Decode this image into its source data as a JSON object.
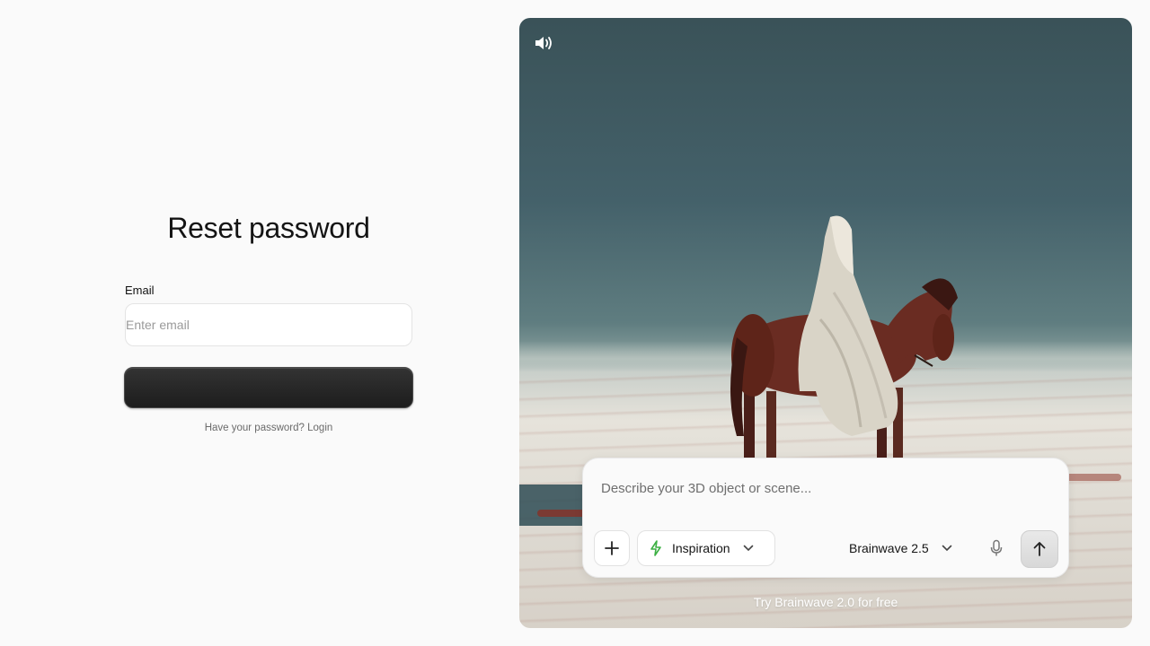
{
  "reset_form": {
    "title": "Reset password",
    "email_label": "Email",
    "email_placeholder": "Enter email",
    "email_value": "",
    "submit_label": "",
    "login_prompt": "Have your password?",
    "login_link": "Login"
  },
  "hero": {
    "sound_icon": "volume-icon"
  },
  "composer": {
    "prompt_placeholder": "Describe your 3D object or scene...",
    "add_icon": "plus-icon",
    "inspiration_icon": "lightning-icon",
    "inspiration_label": "Inspiration",
    "model_label": "Brainwave 2.5",
    "mic_icon": "microphone-icon",
    "send_icon": "arrow-up-icon"
  },
  "promo": {
    "try_free_label": "Try Brainwave 2.0 for free"
  },
  "colors": {
    "button_dark": "#262626",
    "inspiration_accent": "#3cb043",
    "page_bg": "#fafafa"
  }
}
